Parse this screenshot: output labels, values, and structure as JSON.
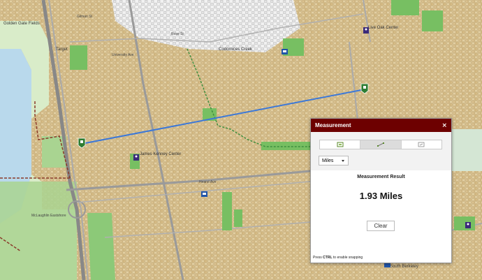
{
  "map": {
    "labels": {
      "golden_gate_fields": "Golden Gate Fields",
      "target": "Target",
      "university_ave": "University Ave",
      "codornices_creek": "Codornices Creek",
      "live_oak_center": "Live Oak Center",
      "james_kenney_center": "James Kenney Center",
      "mcclaughlin_eastshore": "McLaughlin Eastshore",
      "south_berkeley": "South Berkeley",
      "gilman_st": "Gilman St",
      "rose_st": "Rose St",
      "hearst_ave": "Hearst Ave"
    }
  },
  "measurement": {
    "title": "Measurement",
    "close_glyph": "×",
    "unit": "Miles",
    "result_heading": "Measurement Result",
    "result_value": "1.93 Miles",
    "clear_label": "Clear",
    "snap_hint_prefix": "Press ",
    "snap_hint_key": "CTRL",
    "snap_hint_suffix": " to enable snapping"
  }
}
